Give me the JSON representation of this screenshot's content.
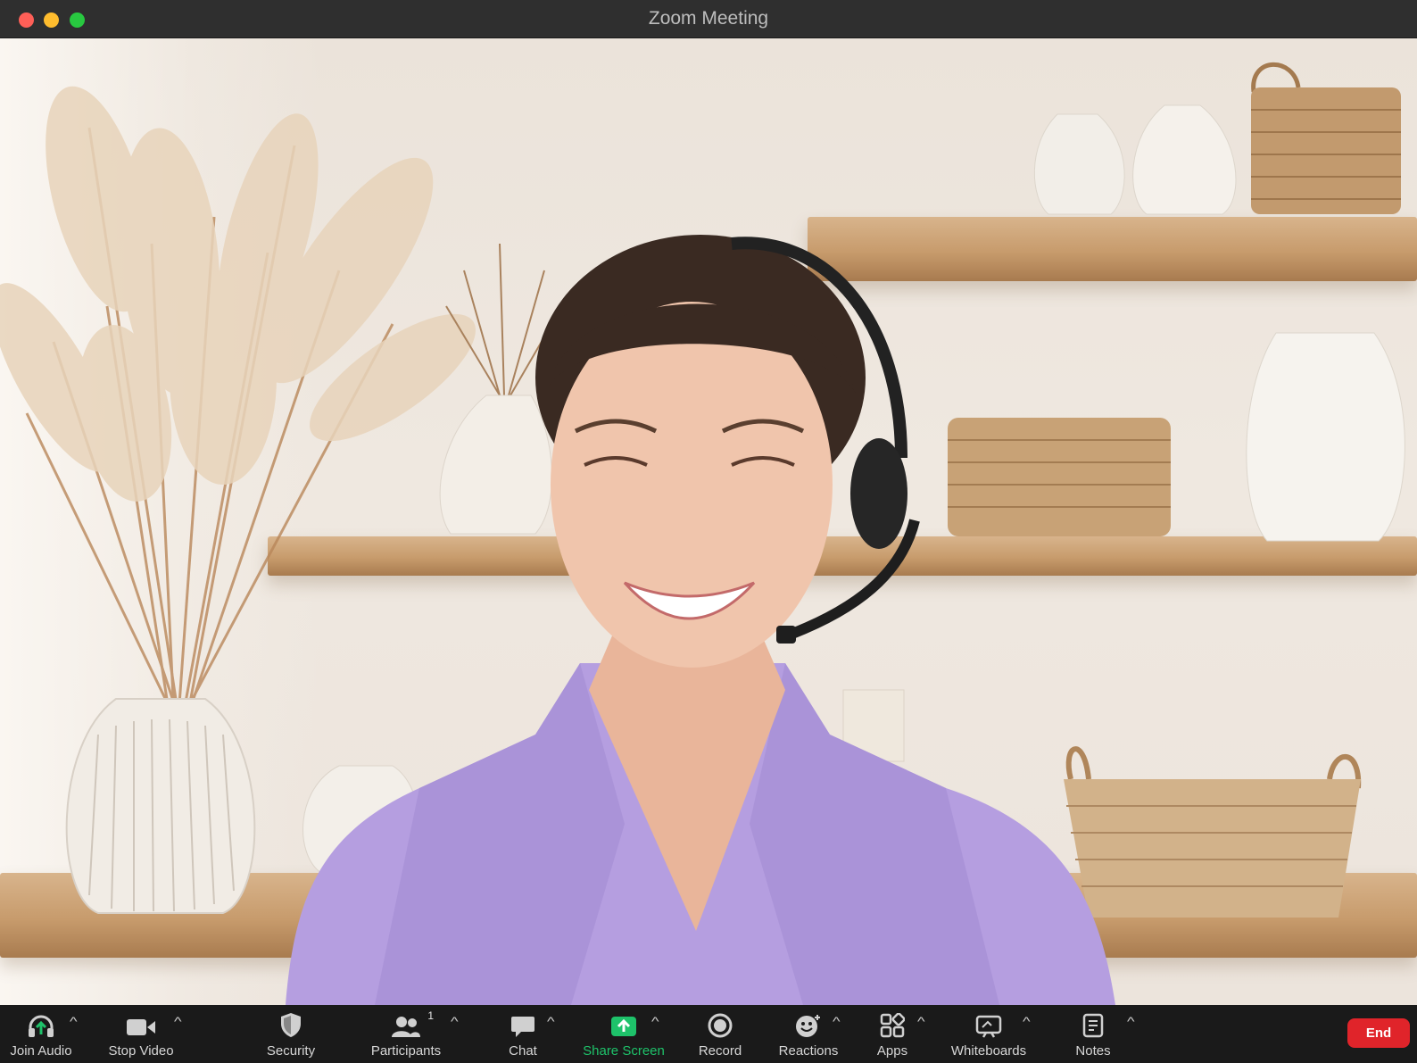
{
  "window": {
    "title": "Zoom Meeting"
  },
  "toolbar": {
    "join_audio": "Join Audio",
    "stop_video": "Stop Video",
    "security": "Security",
    "participants": "Participants",
    "participants_count": "1",
    "chat": "Chat",
    "share_screen": "Share Screen",
    "record": "Record",
    "reactions": "Reactions",
    "apps": "Apps",
    "whiteboards": "Whiteboards",
    "notes": "Notes",
    "end": "End"
  },
  "colors": {
    "end_button": "#e0242a",
    "share_screen_accent": "#1ec26a",
    "title_bar": "#2f2f2f",
    "toolbar": "#1a1a1a"
  },
  "icons": {
    "join_audio": "headphones-icon",
    "stop_video": "video-camera-icon",
    "security": "shield-icon",
    "participants": "people-icon",
    "chat": "chat-bubble-icon",
    "share_screen": "share-arrow-icon",
    "record": "record-icon",
    "reactions": "smiley-icon",
    "apps": "apps-icon",
    "whiteboards": "whiteboard-icon",
    "notes": "notes-icon"
  }
}
